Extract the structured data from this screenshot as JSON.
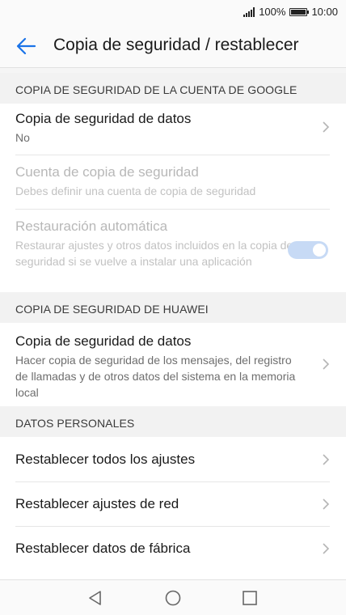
{
  "status": {
    "battery_percent": "100%",
    "time": "10:00"
  },
  "header": {
    "title": "Copia de seguridad / restablecer"
  },
  "sections": {
    "google": {
      "header": "COPIA DE SEGURIDAD DE LA CUENTA DE GOOGLE",
      "backup_data": {
        "title": "Copia de seguridad de datos",
        "subtitle": "No"
      },
      "backup_account": {
        "title": "Cuenta de copia de seguridad",
        "subtitle": "Debes definir una cuenta de copia de seguridad"
      },
      "auto_restore": {
        "title": "Restauración automática",
        "subtitle": "Restaurar ajustes y otros datos incluidos en la copia de seguridad si se vuelve a instalar una aplicación",
        "enabled": true
      }
    },
    "huawei": {
      "header": "COPIA DE SEGURIDAD DE HUAWEI",
      "backup_data": {
        "title": "Copia de seguridad de datos",
        "subtitle": "Hacer copia de seguridad de los mensajes, del registro de llamadas y de otros datos del sistema en la memoria local"
      }
    },
    "personal": {
      "header": "DATOS PERSONALES",
      "reset_all": {
        "title": "Restablecer todos los ajustes"
      },
      "reset_network": {
        "title": "Restablecer ajustes de red"
      },
      "factory_reset": {
        "title": "Restablecer datos de fábrica"
      }
    }
  },
  "colors": {
    "accent": "#1a73e8",
    "toggle_disabled": "#c7daf5"
  }
}
